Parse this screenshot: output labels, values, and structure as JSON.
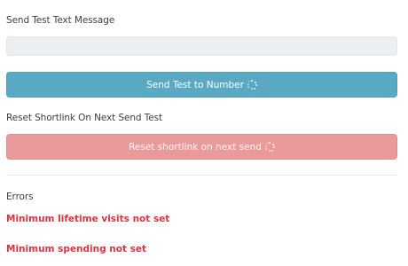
{
  "test_message": {
    "label": "Send Test Text Message",
    "input_value": "",
    "send_button_label": "Send Test to Number"
  },
  "reset_shortlink": {
    "label": "Reset Shortlink On Next Send Test",
    "button_label": "Reset shortlink on next send"
  },
  "errors": {
    "heading": "Errors",
    "items": [
      "Minimum lifetime visits not set",
      "Minimum spending not set"
    ]
  },
  "colors": {
    "primary_button": "#5aa9c4",
    "danger_button": "#eb9a9c",
    "error_text": "#d9353f"
  },
  "icons": {
    "spinner": "spinner-icon"
  }
}
